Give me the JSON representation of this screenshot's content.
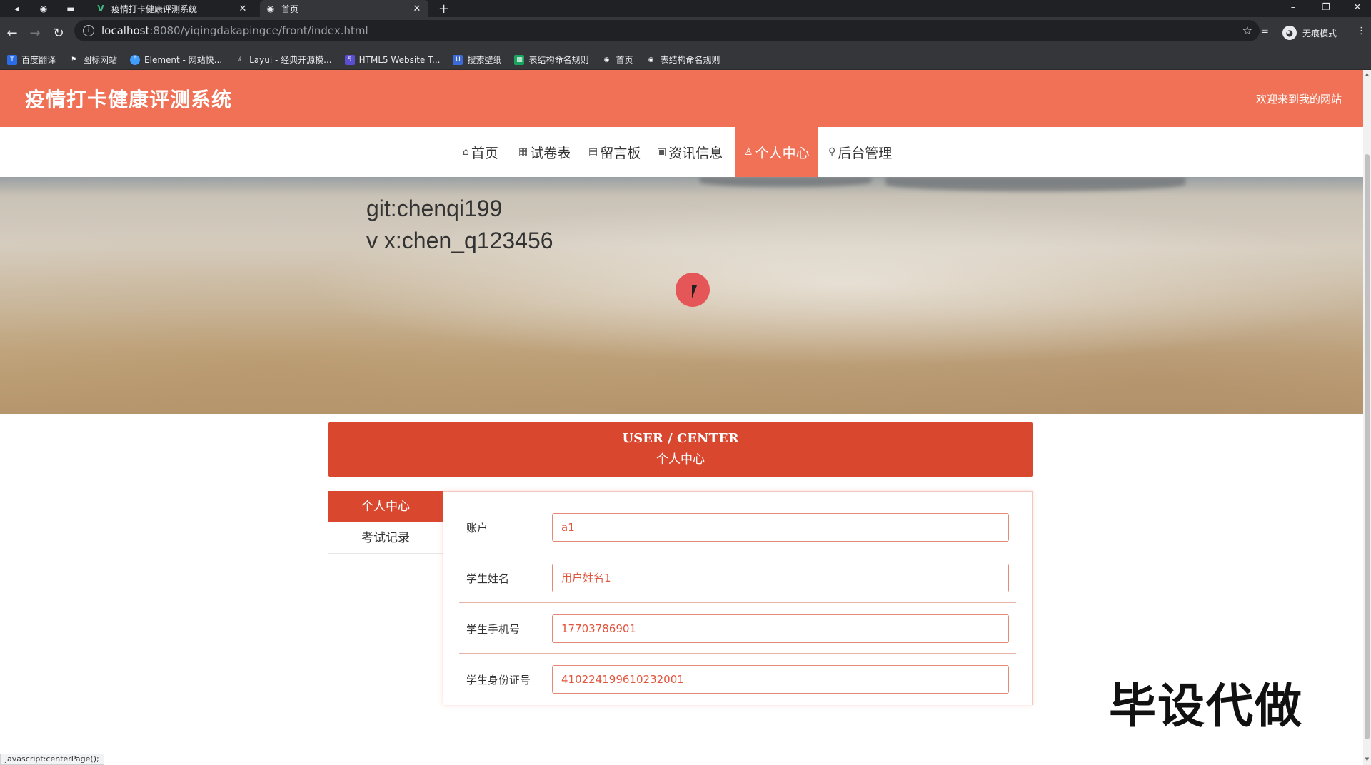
{
  "browser": {
    "tabs": [
      {
        "title": "疫情打卡健康评测系统",
        "favicon": "vue-icon",
        "active": false
      },
      {
        "title": "首页",
        "favicon": "globe-icon",
        "active": true
      }
    ],
    "url_host": "localhost",
    "url_path": ":8080/yiqingdakapingce/front/index.html",
    "profile_label": "无痕模式",
    "bookmarks": [
      {
        "label": "百度翻译",
        "icon": "translate-icon",
        "color": "#2b6de8"
      },
      {
        "label": "图标网站",
        "icon": "flag-icon",
        "color": "#555555"
      },
      {
        "label": "Element - 网站快...",
        "icon": "element-icon",
        "color": "#409eff"
      },
      {
        "label": "Layui - 经典开源模...",
        "icon": "layui-icon",
        "color": "#777777"
      },
      {
        "label": "HTML5 Website T...",
        "icon": "html5-icon",
        "color": "#5b4fd1"
      },
      {
        "label": "搜索壁纸",
        "icon": "wallpaper-icon",
        "color": "#3c6ad6"
      },
      {
        "label": "表结构命名规则",
        "icon": "sheet-icon",
        "color": "#1aa260"
      },
      {
        "label": "首页",
        "icon": "globe-icon",
        "color": "#555555"
      },
      {
        "label": "表结构命名规则",
        "icon": "globe-icon",
        "color": "#555555"
      }
    ],
    "status_text": "javascript:centerPage();"
  },
  "site": {
    "title": "疫情打卡健康评测系统",
    "welcome": "欢迎来到我的网站",
    "accent_color": "#f07155",
    "nav": [
      {
        "label": "首页",
        "icon": "home-icon",
        "active": false
      },
      {
        "label": "试卷表",
        "icon": "grid-icon",
        "active": false
      },
      {
        "label": "留言板",
        "icon": "message-icon",
        "active": false
      },
      {
        "label": "资讯信息",
        "icon": "news-icon",
        "active": false
      },
      {
        "label": "个人中心",
        "icon": "user-icon",
        "active": true
      },
      {
        "label": "后台管理",
        "icon": "link-icon",
        "active": false
      }
    ]
  },
  "banner": {
    "overlay_line1": "git:chenqi199",
    "overlay_line2": "v x:chen_q123456",
    "slide_count": 3,
    "active_slide": 1
  },
  "user_center": {
    "title_en": "USER / CENTER",
    "title_cn": "个人中心",
    "side_menu": [
      {
        "label": "个人中心",
        "active": true
      },
      {
        "label": "考试记录",
        "active": false
      }
    ],
    "fields": [
      {
        "label": "账户",
        "value": "a1"
      },
      {
        "label": "学生姓名",
        "value": "用户姓名1"
      },
      {
        "label": "学生手机号",
        "value": "17703786901"
      },
      {
        "label": "学生身份证号",
        "value": "410224199610232001"
      }
    ]
  },
  "watermark": "毕设代做"
}
